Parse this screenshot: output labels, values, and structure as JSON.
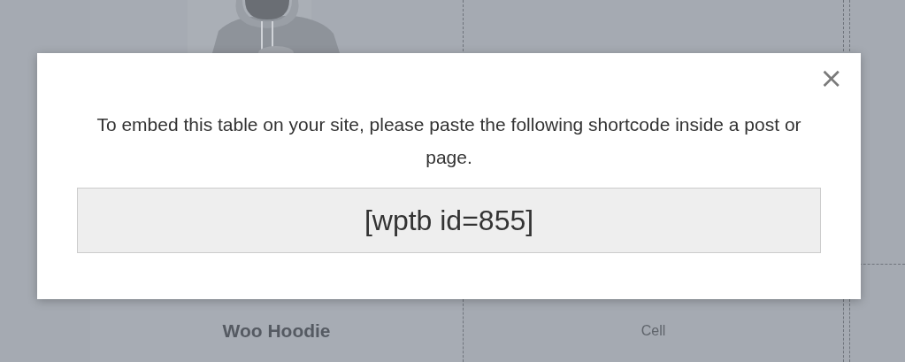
{
  "product_table": {
    "columns": [
      {
        "kind": "product",
        "title": "Woo Hoodie"
      },
      {
        "kind": "placeholder",
        "title": "Cell"
      }
    ]
  },
  "modal": {
    "close": "×",
    "message": "To embed this table on your site, please paste the following shortcode inside a post or page.",
    "shortcode": "[wptb id=855]"
  }
}
